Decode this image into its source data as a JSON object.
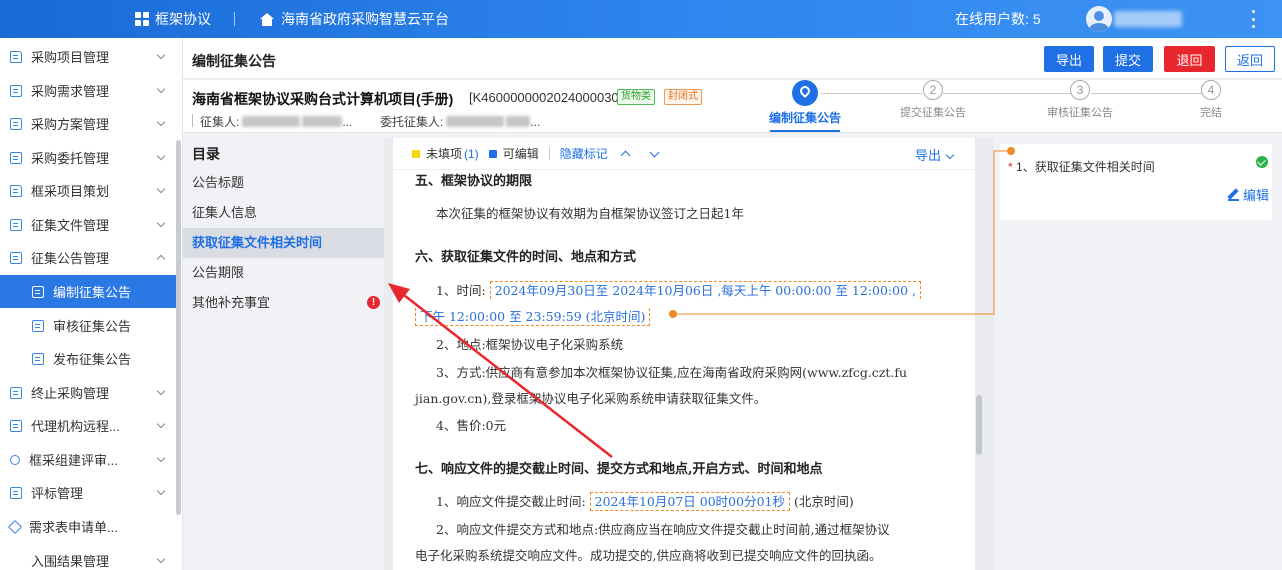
{
  "topbar": {
    "app_name": "框架协议",
    "platform": "海南省政府采购智慧云平台",
    "online_label": "在线用户数:",
    "online_count": "5"
  },
  "sidebar": {
    "items": [
      {
        "label": "采购项目管理"
      },
      {
        "label": "采购需求管理"
      },
      {
        "label": "采购方案管理"
      },
      {
        "label": "采购委托管理"
      },
      {
        "label": "框采项目策划"
      },
      {
        "label": "征集文件管理"
      },
      {
        "label": "征集公告管理"
      },
      {
        "label": "编制征集公告"
      },
      {
        "label": "审核征集公告"
      },
      {
        "label": "发布征集公告"
      },
      {
        "label": "终止采购管理"
      },
      {
        "label": "代理机构远程..."
      },
      {
        "label": "框采组建评审..."
      },
      {
        "label": "评标管理"
      },
      {
        "label": "需求表申请单..."
      },
      {
        "label": "入围结果管理"
      }
    ]
  },
  "header": {
    "title": "编制征集公告",
    "buttons": {
      "export": "导出",
      "submit": "提交",
      "return": "退回",
      "back": "返回"
    }
  },
  "project": {
    "name": "海南省框架协议采购台式计算机项目(手册)",
    "code": "[K4600000002024000030]",
    "tag_goods": "货物类",
    "tag_closed": "封闭式",
    "collector_label": "征集人:",
    "collector_suffix": "...",
    "delegate_label": "委托征集人:",
    "delegate_suffix": "..."
  },
  "steps": [
    {
      "num": "",
      "label": "编制征集公告"
    },
    {
      "num": "2",
      "label": "提交征集公告"
    },
    {
      "num": "3",
      "label": "审核征集公告"
    },
    {
      "num": "4",
      "label": "完结"
    }
  ],
  "toc": {
    "title": "目录",
    "items": [
      "公告标题",
      "征集人信息",
      "获取征集文件相关时间",
      "公告期限",
      "其他补充事宜"
    ],
    "error_mark": "!"
  },
  "doc_toolbar": {
    "unfilled_label": "未填项",
    "unfilled_count": "(1)",
    "editable_label": "可编辑",
    "hide_marks": "隐藏标记",
    "export": "导出",
    "colors": {
      "unfilled": "#f5d90a",
      "editable": "#1f6fe5"
    }
  },
  "doc": {
    "h5": "五、框架协议的期限",
    "p5": "本次征集的框架协议有效期为自框架协议签订之日起1年",
    "h6": "六、获取征集文件的时间、地点和方式",
    "time_label": "1、时间:",
    "time_value_1": "2024年09月30日至 2024年10月06日 ,每天上午 00:00:00 至 12:00:00 ,",
    "time_value_2": "下午 12:00:00 至 23:59:59 (北京时间)",
    "place": "2、地点:框架协议电子化采购系统",
    "method_1": "3、方式:供应商有意参加本次框架协议征集,应在海南省政府采购网(www.zfcg.czt.fu",
    "method_2": "jian.gov.cn),登录框架协议电子化采购系统申请获取征集文件。",
    "price": "4、售价:0元",
    "h7": "七、响应文件的提交截止时间、提交方式和地点,开启方式、时间和地点",
    "deadline_label": "1、响应文件提交截止时间:",
    "deadline_value": "2024年10月07日 00时00分01秒",
    "deadline_suffix": "(北京时间)",
    "submit_1": "2、响应文件提交方式和地点:供应商应当在响应文件提交截止时间前,通过框架协议",
    "submit_2": "电子化采购系统提交响应文件。成功提交的,供应商将收到已提交响应文件的回执函。"
  },
  "right_panel": {
    "star": "*",
    "item_label": "1、获取征集文件相关时间",
    "edit": "编辑"
  }
}
